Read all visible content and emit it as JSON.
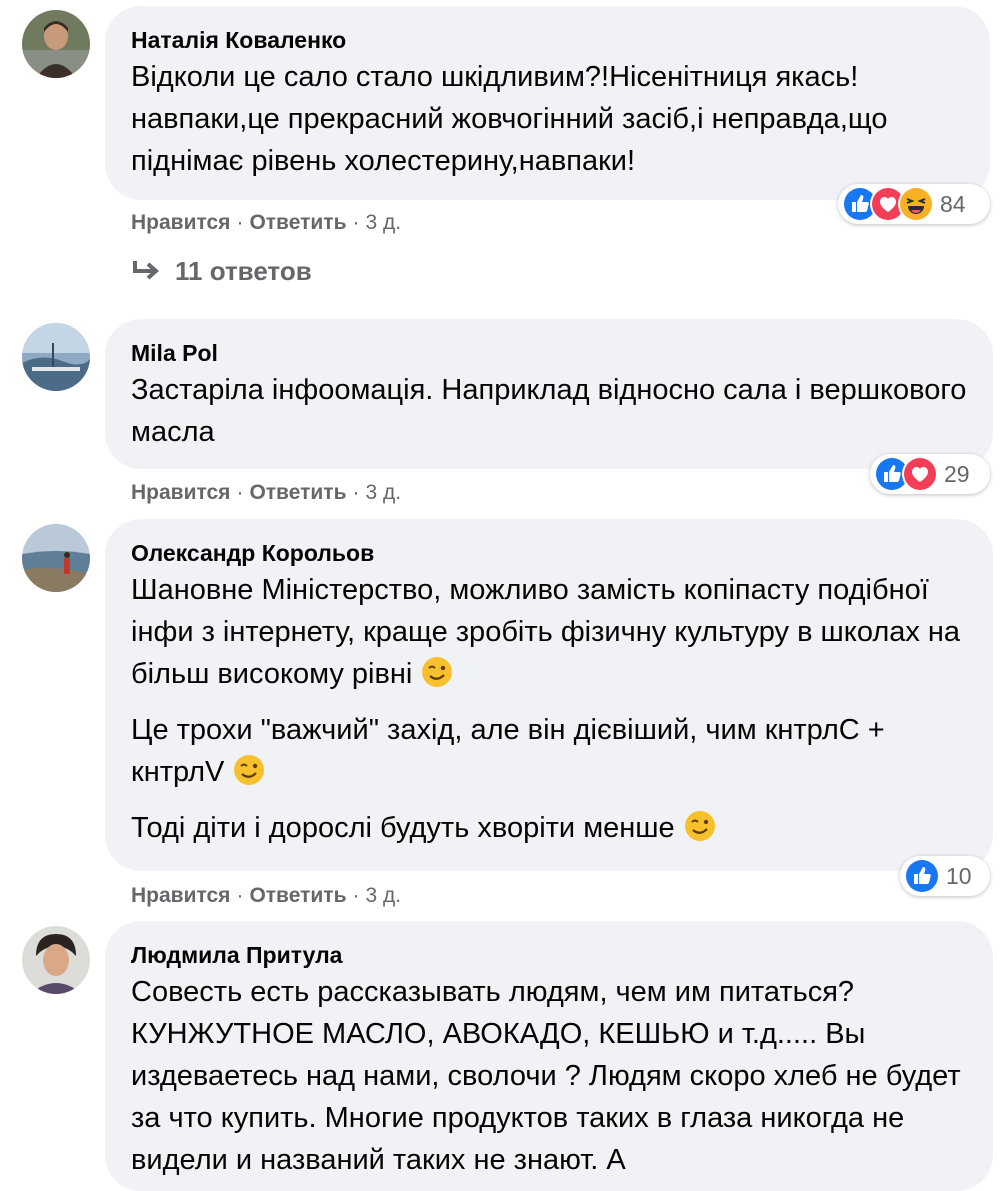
{
  "actions": {
    "like": "Нравится",
    "reply": "Ответить",
    "dot": "·"
  },
  "comments": [
    {
      "author": "Наталія Коваленко",
      "paragraphs": [
        "Відколи це сало стало шкідливим?!Нісенітниця якась! навпаки,це прекрасний жовчогінний засіб,і неправда,що піднімає рівень холестерину,навпаки!"
      ],
      "time": "3 д.",
      "reactions": [
        "like",
        "love",
        "haha"
      ],
      "reaction_count": "84",
      "replies": "11 ответов"
    },
    {
      "author": "Mila Pol",
      "paragraphs": [
        "Застаріла інфоомація. Наприклад відносно сала і вершкового масла"
      ],
      "time": "3 д.",
      "reactions": [
        "like",
        "love"
      ],
      "reaction_count": "29"
    },
    {
      "author": "Олександр Корольов",
      "paragraphs": [
        "Шановне Міністерство, можливо замість копіпасту подібної інфи з інтернету, краще зробіть фізичну культуру в школах на більш високому рівні",
        "Це трохи \"важчий\" захід, але він дієвіший, чим кнтрлС + кнтрлV",
        "Тоді діти і дорослі будуть хворіти менше"
      ],
      "paragraph_emoji": "wink",
      "time": "3 д.",
      "reactions": [
        "like"
      ],
      "reaction_count": "10"
    },
    {
      "author": "Людмила Притула",
      "paragraphs": [
        "Совесть есть рассказывать людям, чем им питаться? КУНЖУТНОЕ МАСЛО, АВОКАДО, КЕШЬЮ и т.д..... Вы издеваетесь над нами, сволочи ? Людям скоро хлеб не будет за что купить. Многие продуктов таких в глаза никогда не видели и названий таких не знают. А"
      ]
    }
  ]
}
